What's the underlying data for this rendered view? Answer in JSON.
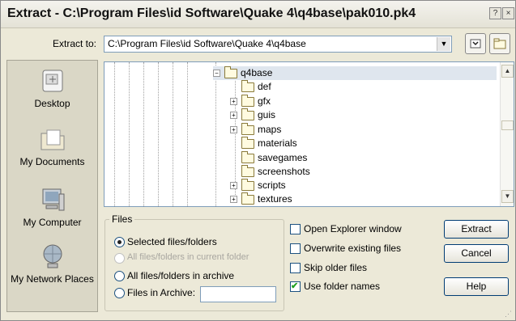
{
  "window": {
    "title": "Extract - C:\\Program Files\\id Software\\Quake 4\\q4base\\pak010.pk4",
    "help_glyph": "?",
    "close_glyph": "×"
  },
  "extract_to": {
    "label": "Extract to:",
    "value": "C:\\Program Files\\id Software\\Quake 4\\q4base"
  },
  "places": [
    {
      "label": "Desktop",
      "icon": "desktop-icon"
    },
    {
      "label": "My Documents",
      "icon": "my-documents-icon"
    },
    {
      "label": "My Computer",
      "icon": "my-computer-icon"
    },
    {
      "label": "My Network Places",
      "icon": "network-places-icon"
    }
  ],
  "tree": {
    "root": {
      "label": "q4base",
      "expander": "−"
    },
    "children": [
      {
        "label": "def",
        "expander": ""
      },
      {
        "label": "gfx",
        "expander": "+"
      },
      {
        "label": "guis",
        "expander": "+"
      },
      {
        "label": "maps",
        "expander": "+"
      },
      {
        "label": "materials",
        "expander": ""
      },
      {
        "label": "savegames",
        "expander": ""
      },
      {
        "label": "screenshots",
        "expander": ""
      },
      {
        "label": "scripts",
        "expander": "+"
      },
      {
        "label": "textures",
        "expander": "+"
      }
    ]
  },
  "files_group": {
    "title": "Files",
    "options": [
      {
        "label": "Selected files/folders",
        "selected": true,
        "enabled": true
      },
      {
        "label": "All files/folders in current folder",
        "selected": false,
        "enabled": false
      },
      {
        "label": "All files/folders in archive",
        "selected": false,
        "enabled": true
      },
      {
        "label": "Files in Archive:",
        "selected": false,
        "enabled": true
      }
    ],
    "files_in_archive_value": ""
  },
  "checkboxes": [
    {
      "label": "Open Explorer window",
      "checked": false
    },
    {
      "label": "Overwrite existing files",
      "checked": false
    },
    {
      "label": "Skip older files",
      "checked": false
    },
    {
      "label": "Use folder names",
      "checked": true
    }
  ],
  "buttons": {
    "extract": "Extract",
    "cancel": "Cancel",
    "help": "Help"
  },
  "glyphs": {
    "combo_arrow": "▼",
    "scroll_up": "▲",
    "scroll_down": "▼",
    "check": "✔"
  }
}
